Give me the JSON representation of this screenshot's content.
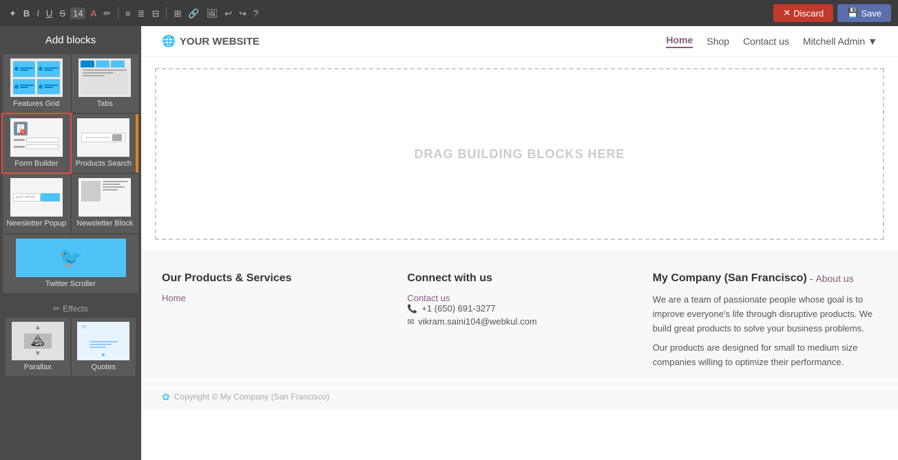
{
  "toolbar": {
    "discard_label": "Discard",
    "save_label": "Save",
    "font_size": "14"
  },
  "sidebar": {
    "title": "Add blocks",
    "blocks": [
      {
        "id": "features-grid",
        "label": "Features Grid",
        "state": ""
      },
      {
        "id": "tabs",
        "label": "Tabs",
        "state": ""
      },
      {
        "id": "form-builder",
        "label": "Form Builder",
        "state": "active-outline"
      },
      {
        "id": "products-search",
        "label": "Products Search",
        "state": "active-orange"
      },
      {
        "id": "newsletter-popup",
        "label": "Newsletter Popup",
        "state": ""
      },
      {
        "id": "newsletter-block",
        "label": "Newsletter Block",
        "state": ""
      },
      {
        "id": "twitter-scroller",
        "label": "Twitter Scroller",
        "state": ""
      }
    ],
    "effects_title": "Effects",
    "effects_blocks": [
      {
        "id": "parallax",
        "label": "Parallax"
      },
      {
        "id": "quotes",
        "label": "Quotes"
      }
    ]
  },
  "website": {
    "logo": "YOUR WEBSITE",
    "nav": {
      "links": [
        "Home",
        "Shop",
        "Contact us"
      ],
      "active_link": "Home",
      "user": "Mitchell Admin"
    },
    "drop_zone_text": "DRAG BUILDING BLOCKS HERE"
  },
  "footer": {
    "col1": {
      "title": "Our Products & Services",
      "links": [
        "Home"
      ]
    },
    "col2": {
      "title": "Connect with us",
      "contact_link": "Contact us",
      "phone": "+1 (650) 691-3277",
      "email": "vikram.saini104@webkul.com"
    },
    "col3": {
      "company": "My Company (San Francisco)",
      "about_label": "About us",
      "desc1": "We are a team of passionate people whose goal is to improve everyone's life through disruptive products. We build great products to solve your business problems.",
      "desc2": "Our products are designed for small to medium size companies willing to optimize their performance."
    },
    "copyright": "Copyright © My Company (San Francisco)"
  }
}
